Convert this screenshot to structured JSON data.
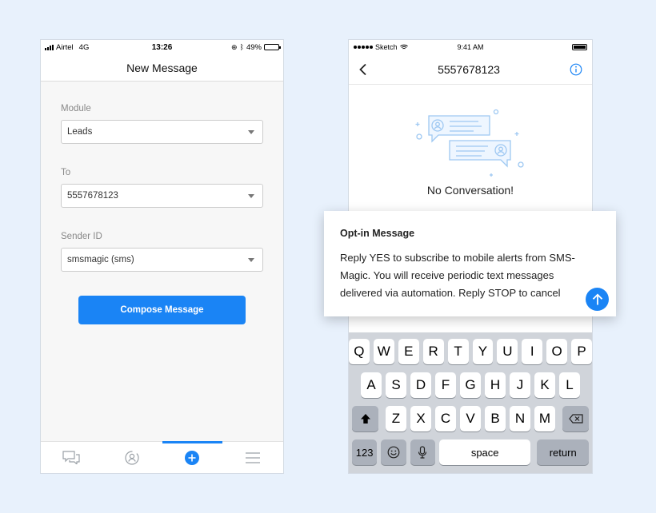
{
  "left": {
    "status": {
      "carrier": "Airtel",
      "network": "4G",
      "time": "13:26",
      "battery": "49%"
    },
    "title": "New Message",
    "fields": [
      {
        "label": "Module",
        "value": "Leads"
      },
      {
        "label": "To",
        "value": "5557678123"
      },
      {
        "label": "Sender ID",
        "value": "smsmagic (sms)"
      }
    ],
    "compose_label": "Compose Message",
    "tabs": [
      "conversations-icon",
      "contact-sync-icon",
      "compose-plus-icon",
      "menu-icon"
    ],
    "active_tab": 2,
    "battery_level": 0.49
  },
  "right": {
    "status": {
      "carrier": "Sketch",
      "time": "9:41 AM"
    },
    "title": "5557678123",
    "empty_text": "No Conversation!",
    "keyboard": {
      "row1": [
        "Q",
        "W",
        "E",
        "R",
        "T",
        "Y",
        "U",
        "I",
        "O",
        "P"
      ],
      "row2": [
        "A",
        "S",
        "D",
        "F",
        "G",
        "H",
        "J",
        "K",
        "L"
      ],
      "row3": [
        "Z",
        "X",
        "C",
        "V",
        "B",
        "N",
        "M"
      ],
      "num_label": "123",
      "space_label": "space",
      "return_label": "return"
    }
  },
  "optin": {
    "title": "Opt-in Message",
    "body": "Reply YES to subscribe to mobile alerts from SMS-Magic. You will receive periodic text messages delivered via automation. Reply STOP to cancel"
  },
  "colors": {
    "accent": "#1a84f5",
    "background": "#e8f1fc",
    "illustration": "#9ec8f2"
  }
}
